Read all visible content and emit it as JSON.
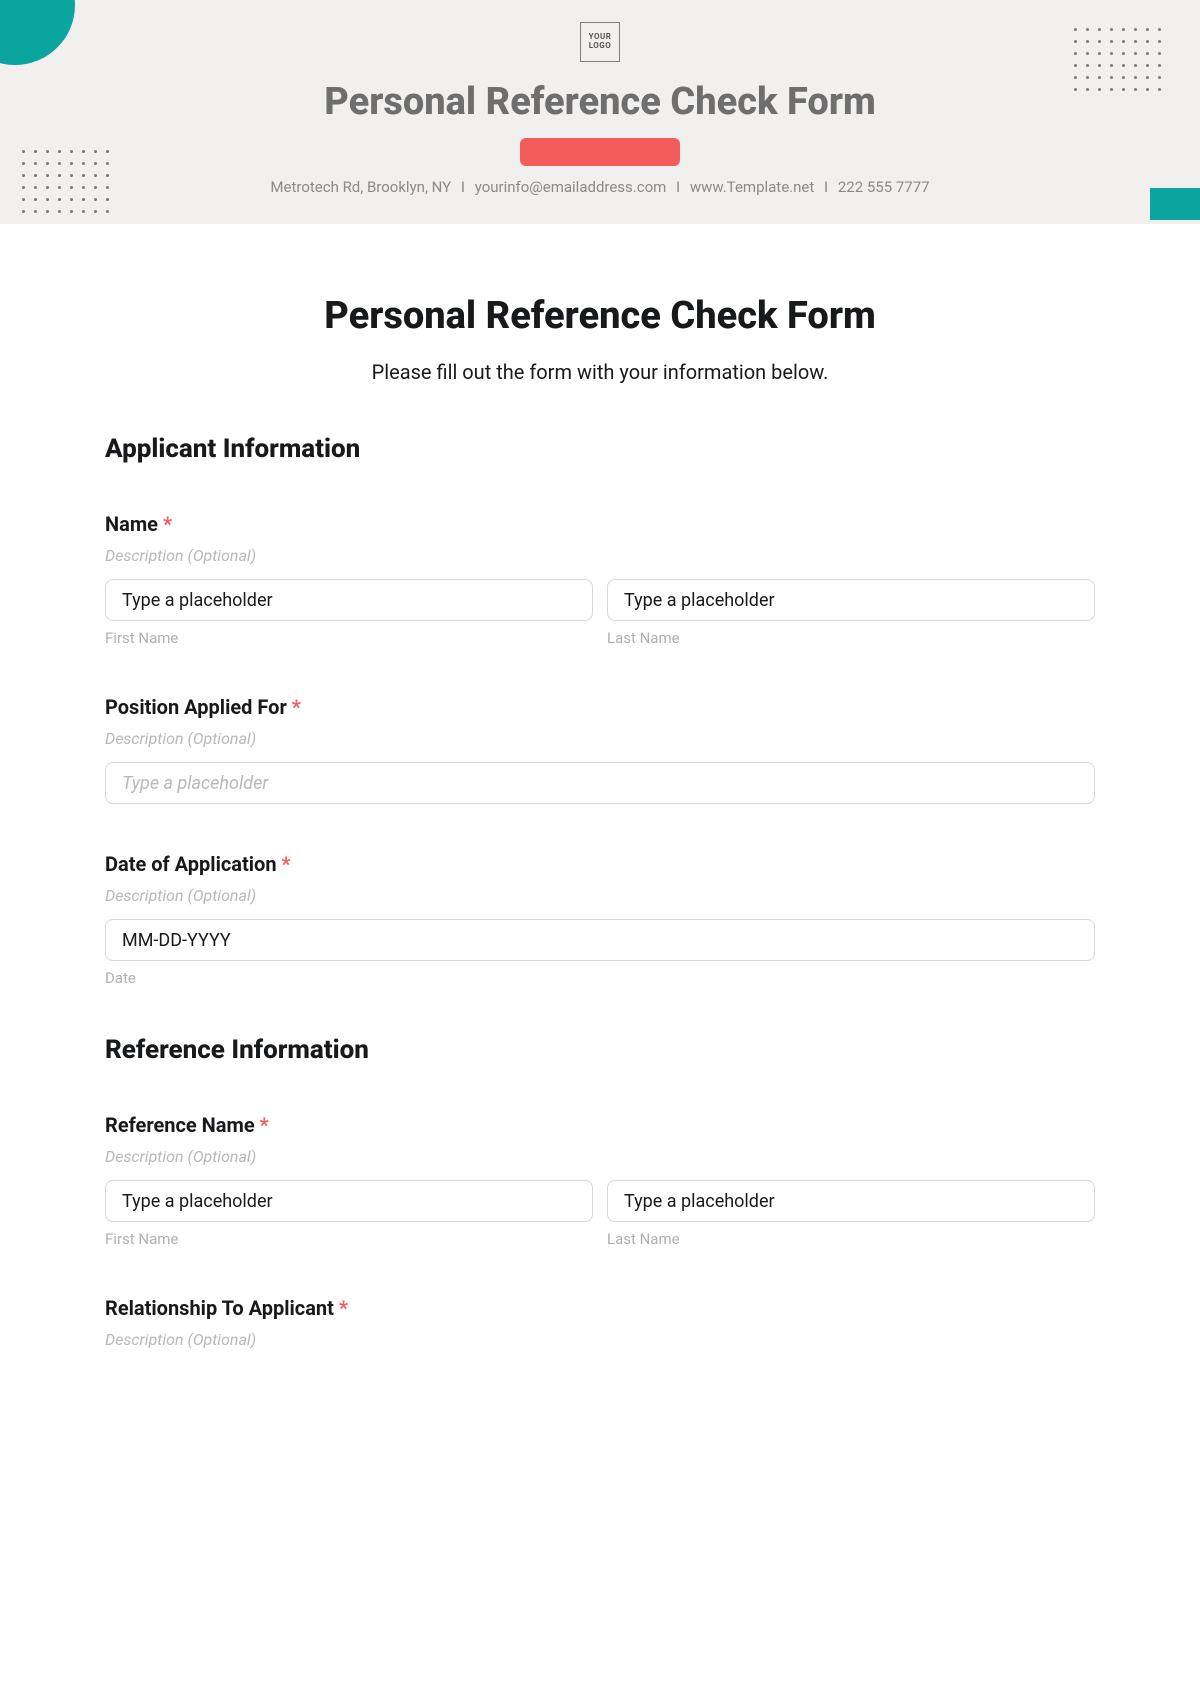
{
  "header": {
    "logo_text": "YOUR LOGO",
    "banner_title": "Personal Reference Check Form",
    "contact": {
      "address": "Metrotech Rd, Brooklyn, NY",
      "email": "yourinfo@emailaddress.com",
      "website": "www.Template.net",
      "phone": "222 555 7777"
    }
  },
  "main": {
    "title": "Personal Reference Check Form",
    "subtitle": "Please fill out the form with your information below."
  },
  "separator": "I",
  "sections": {
    "applicant": {
      "title": "Applicant Information",
      "name": {
        "label": "Name",
        "desc": "Description (Optional)",
        "first_placeholder": "Type a placeholder",
        "last_placeholder": "Type a placeholder",
        "first_sub": "First Name",
        "last_sub": "Last Name"
      },
      "position": {
        "label": "Position Applied For",
        "desc": "Description (Optional)",
        "placeholder": "Type a placeholder"
      },
      "date": {
        "label": "Date of Application",
        "desc": "Description (Optional)",
        "placeholder": "MM-DD-YYYY",
        "sub": "Date"
      }
    },
    "reference": {
      "title": "Reference Information",
      "name": {
        "label": "Reference Name",
        "desc": "Description (Optional)",
        "first_placeholder": "Type a placeholder",
        "last_placeholder": "Type a placeholder",
        "first_sub": "First Name",
        "last_sub": "Last Name"
      },
      "relationship": {
        "label": "Relationship To Applicant",
        "desc": "Description (Optional)"
      }
    }
  },
  "required_marker": "*"
}
